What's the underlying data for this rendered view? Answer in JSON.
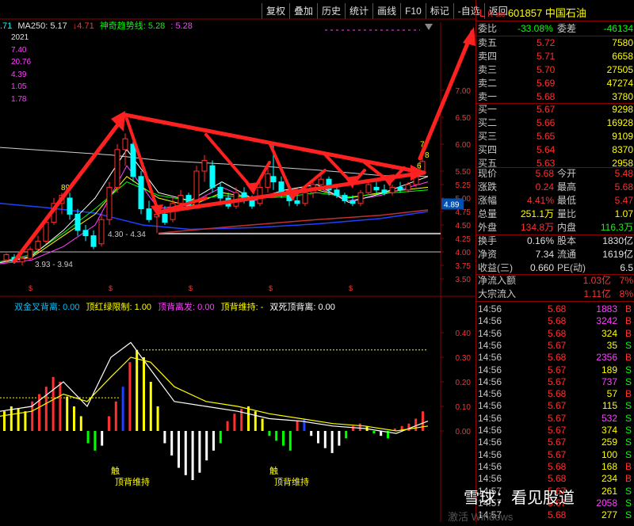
{
  "toolbar": [
    "复权",
    "叠加",
    "历史",
    "统计",
    "画线",
    "F10",
    "标记",
    "-自选",
    "返回"
  ],
  "info": {
    "prefix": ".71",
    "ma250": "MA250: 5.17",
    "ma250_val2": "↓4.71",
    "magic": "神奇趋势线: 5.28",
    "magic_val2": ": 5.28"
  },
  "left_values": [
    "2021",
    "7.40",
    "20.76",
    "4.39",
    "1.05",
    "1.78"
  ],
  "price_axis": {
    "ticks": [
      "7.00",
      "6.50",
      "6.00",
      "5.50",
      "5.25",
      "5.00",
      "4.75",
      "4.50",
      "4.25",
      "4.00",
      "3.75",
      "3.50"
    ],
    "current_price": "4.89"
  },
  "price_labels": {
    "high": "6.20",
    "low_a": "4.30",
    "low_b": "4.34",
    "low_c": "3.93",
    "low_d": "3.94",
    "mark7": "7",
    "mark8": "8",
    "mark6": "6",
    "mark5": "5",
    "mark89": "89"
  },
  "ind_axis": {
    "ticks": [
      "0.40",
      "0.30",
      "0.20",
      "0.10",
      "0.00"
    ]
  },
  "ind_legend": [
    {
      "text": "双金叉背离: 0.00",
      "color": "#00c0ff"
    },
    {
      "text": "顶红绿限制: 1.00",
      "color": "#ffff00"
    },
    {
      "text": "顶背离发: 0.00",
      "color": "#ff40ff"
    },
    {
      "text": "顶背维持: -",
      "color": "#ffff00"
    },
    {
      "text": "双死顶背离: 0.00",
      "color": "#ffffff"
    }
  ],
  "ind_labels": {
    "chu1": "触",
    "label1": "顶背维持",
    "chu2": "触",
    "label2": "顶背维持"
  },
  "stock": {
    "code": "601857",
    "name": "中国石油",
    "l_mark": "L",
    "r_mark": "R",
    "r_sub": "300"
  },
  "weibi": {
    "label": "委比",
    "value": "-33.08%",
    "label2": "委差",
    "value2": "-46134"
  },
  "sells": [
    {
      "label": "卖五",
      "price": "5.72",
      "vol": "7580"
    },
    {
      "label": "卖四",
      "price": "5.71",
      "vol": "6658"
    },
    {
      "label": "卖三",
      "price": "5.70",
      "vol": "27505"
    },
    {
      "label": "卖二",
      "price": "5.69",
      "vol": "47274"
    },
    {
      "label": "卖一",
      "price": "5.68",
      "vol": "3780"
    }
  ],
  "buys": [
    {
      "label": "买一",
      "price": "5.67",
      "vol": "9298"
    },
    {
      "label": "买二",
      "price": "5.66",
      "vol": "16928"
    },
    {
      "label": "买三",
      "price": "5.65",
      "vol": "9109"
    },
    {
      "label": "买四",
      "price": "5.64",
      "vol": "8370"
    },
    {
      "label": "买五",
      "price": "5.63",
      "vol": "2958"
    }
  ],
  "stats": [
    {
      "l1": "现价",
      "v1": "5.68",
      "c1": "#ff3030",
      "l2": "今开",
      "v2": "5.48",
      "c2": "#ff3030"
    },
    {
      "l1": "涨跌",
      "v1": "0.24",
      "c1": "#ff3030",
      "l2": "最高",
      "v2": "5.68",
      "c2": "#ff3030"
    },
    {
      "l1": "涨幅",
      "v1": "4.41%",
      "c1": "#ff3030",
      "l2": "最低",
      "v2": "5.47",
      "c2": "#ff3030"
    },
    {
      "l1": "总量",
      "v1": "251.1万",
      "c1": "#ffff00",
      "l2": "量比",
      "v2": "1.07",
      "c2": "#ffff00"
    },
    {
      "l1": "外盘",
      "v1": "134.8万",
      "c1": "#ff3030",
      "l2": "内盘",
      "v2": "116.3万",
      "c2": "#00ff00"
    }
  ],
  "stats2": [
    {
      "l1": "换手",
      "v1": "0.16%",
      "c1": "#e0e0e0",
      "l2": "股本",
      "v2": "1830亿",
      "c2": "#e0e0e0"
    },
    {
      "l1": "净资",
      "v1": "7.34",
      "c1": "#e0e0e0",
      "l2": "流通",
      "v2": "1619亿",
      "c2": "#e0e0e0"
    },
    {
      "l1": "收益(三)",
      "v1": "0.660",
      "c1": "#e0e0e0",
      "l2": "PE(动)",
      "v2": "6.5",
      "c2": "#e0e0e0"
    }
  ],
  "flows": [
    {
      "label": "净流入额",
      "value": "1.03亿",
      "pct": "7%"
    },
    {
      "label": "大宗流入",
      "value": "1.11亿",
      "pct": "8%"
    }
  ],
  "ticks": [
    {
      "t": "14:56",
      "p": "5.68",
      "pc": "#ff3030",
      "v": "1883",
      "vc": "#ff40ff",
      "d": "B"
    },
    {
      "t": "14:56",
      "p": "5.68",
      "pc": "#ff3030",
      "v": "3242",
      "vc": "#ff40ff",
      "d": "B"
    },
    {
      "t": "14:56",
      "p": "5.68",
      "pc": "#ff3030",
      "v": "324",
      "vc": "#ffff00",
      "d": "B"
    },
    {
      "t": "14:56",
      "p": "5.67",
      "pc": "#ff3030",
      "v": "35",
      "vc": "#ffff00",
      "d": "S"
    },
    {
      "t": "14:56",
      "p": "5.68",
      "pc": "#ff3030",
      "v": "2356",
      "vc": "#ff40ff",
      "d": "B"
    },
    {
      "t": "14:56",
      "p": "5.67",
      "pc": "#ff3030",
      "v": "189",
      "vc": "#ffff00",
      "d": "S"
    },
    {
      "t": "14:56",
      "p": "5.67",
      "pc": "#ff3030",
      "v": "737",
      "vc": "#ff40ff",
      "d": "S"
    },
    {
      "t": "14:56",
      "p": "5.68",
      "pc": "#ff3030",
      "v": "57",
      "vc": "#ffff00",
      "d": "B"
    },
    {
      "t": "14:56",
      "p": "5.67",
      "pc": "#ff3030",
      "v": "115",
      "vc": "#ffff00",
      "d": "S"
    },
    {
      "t": "14:56",
      "p": "5.67",
      "pc": "#ff3030",
      "v": "532",
      "vc": "#ff40ff",
      "d": "S"
    },
    {
      "t": "14:56",
      "p": "5.67",
      "pc": "#ff3030",
      "v": "374",
      "vc": "#ffff00",
      "d": "S"
    },
    {
      "t": "14:56",
      "p": "5.67",
      "pc": "#ff3030",
      "v": "259",
      "vc": "#ffff00",
      "d": "S"
    },
    {
      "t": "14:56",
      "p": "5.67",
      "pc": "#ff3030",
      "v": "100",
      "vc": "#ffff00",
      "d": "S"
    },
    {
      "t": "14:56",
      "p": "5.68",
      "pc": "#ff3030",
      "v": "168",
      "vc": "#ffff00",
      "d": "B"
    },
    {
      "t": "14:56",
      "p": "5.68",
      "pc": "#ff3030",
      "v": "234",
      "vc": "#ffff00",
      "d": "B"
    },
    {
      "t": "14:57",
      "p": "5.67",
      "pc": "#ff3030",
      "v": "261",
      "vc": "#ffff00",
      "d": "S"
    },
    {
      "t": "14:57",
      "p": "5.67",
      "pc": "#ff3030",
      "v": "2058",
      "vc": "#ff40ff",
      "d": "S"
    },
    {
      "t": "14:57",
      "p": "5.68",
      "pc": "#ff3030",
      "v": "277",
      "vc": "#ffff00",
      "d": "S"
    }
  ],
  "watermark": "雪球：看见股道",
  "activate": "激活 Windows",
  "colors": {
    "up": "#ff3030",
    "down": "#00ff00",
    "label": "#c8c8c8",
    "grid": "#8b0000"
  }
}
